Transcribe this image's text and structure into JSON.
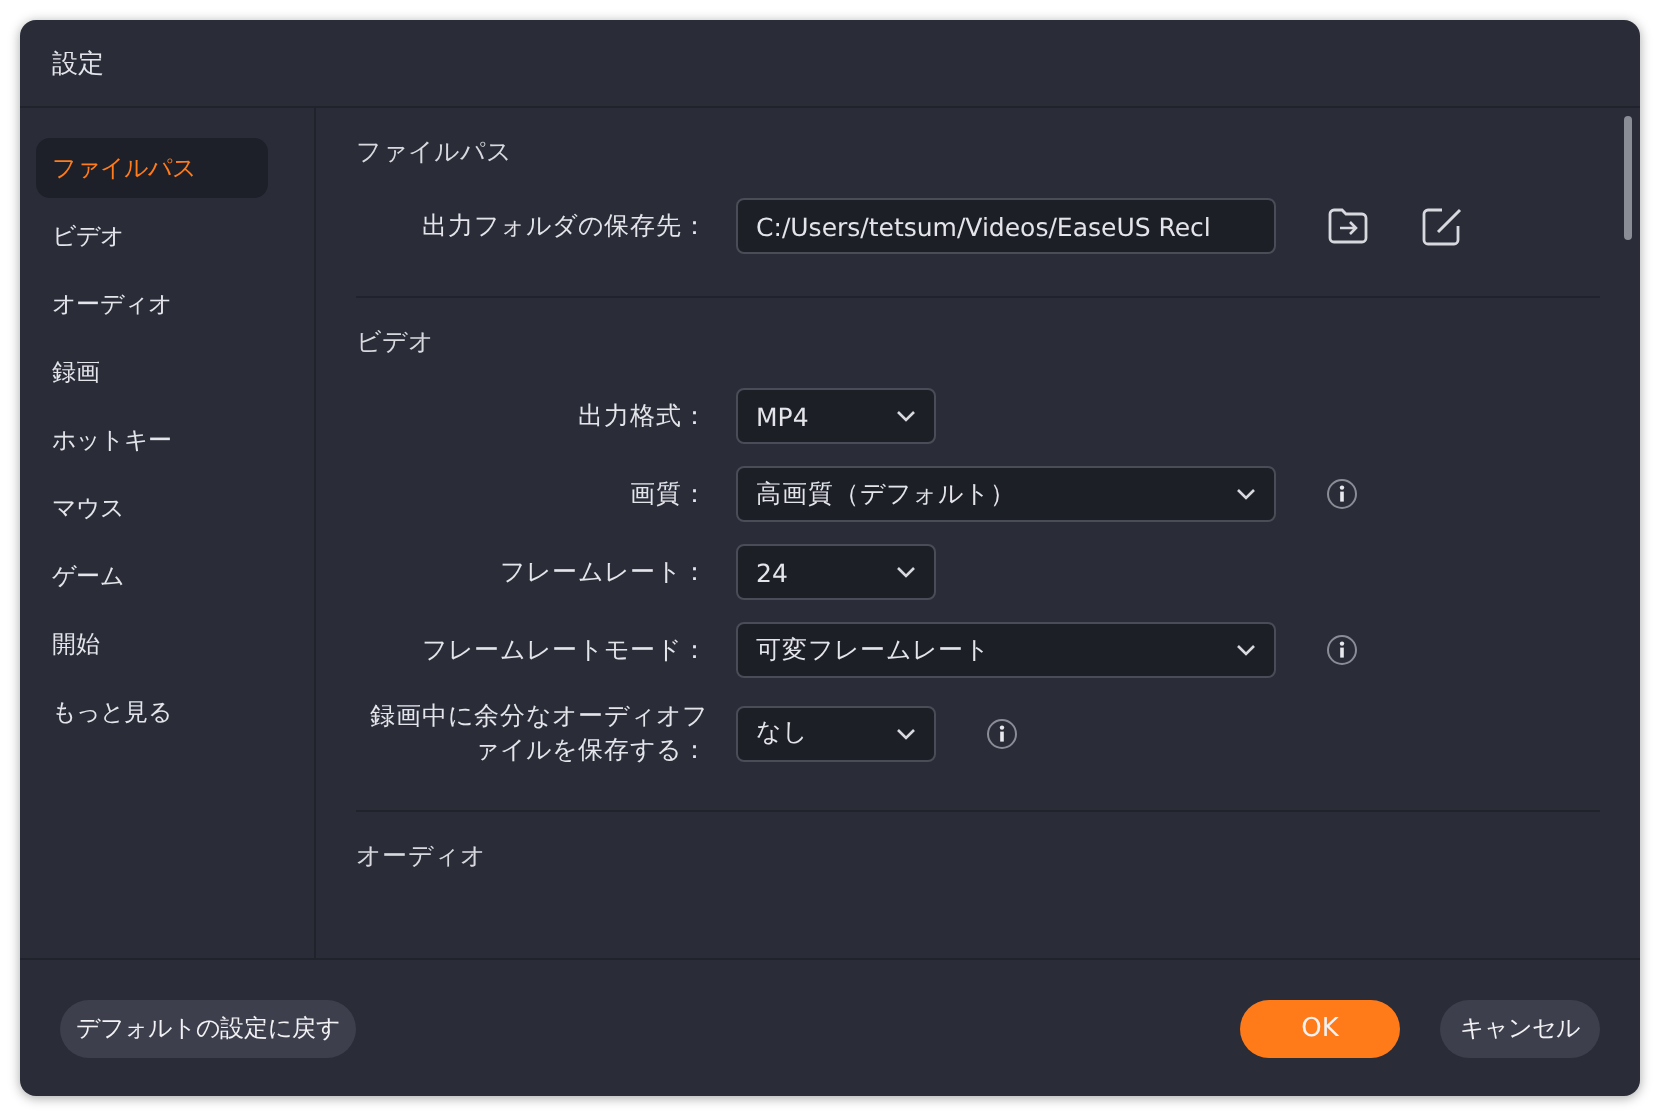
{
  "window": {
    "title": "設定"
  },
  "sidebar": {
    "items": [
      {
        "label": "ファイルパス",
        "selected": true
      },
      {
        "label": "ビデオ",
        "selected": false
      },
      {
        "label": "オーディオ",
        "selected": false
      },
      {
        "label": "録画",
        "selected": false
      },
      {
        "label": "ホットキー",
        "selected": false
      },
      {
        "label": "マウス",
        "selected": false
      },
      {
        "label": "ゲーム",
        "selected": false
      },
      {
        "label": "開始",
        "selected": false
      },
      {
        "label": "もっと見る",
        "selected": false
      }
    ]
  },
  "sections": [
    {
      "title": "ファイルパス",
      "rows": [
        {
          "kind": "path",
          "label": "出力フォルダの保存先：",
          "value": "C:/Users/tetsum/Videos/EaseUS Recl"
        }
      ]
    },
    {
      "title": "ビデオ",
      "rows": [
        {
          "kind": "select",
          "label": "出力格式：",
          "value": "MP4",
          "info": false
        },
        {
          "kind": "wideselect",
          "label": "画質：",
          "value": "高画質（デフォルト）",
          "info": true
        },
        {
          "kind": "select",
          "label": "フレームレート：",
          "value": "24",
          "info": false
        },
        {
          "kind": "wideselect",
          "label": "フレームレートモード：",
          "value": "可変フレームレート",
          "info": true
        },
        {
          "kind": "select",
          "label": "録画中に余分なオーディオファイルを保存する：",
          "value": "なし",
          "info": true
        }
      ]
    },
    {
      "title": "オーディオ"
    }
  ],
  "footer": {
    "reset_button": "デフォルトの設定に戻す",
    "ok_button": "OK",
    "cancel_button": "キャンセル"
  }
}
